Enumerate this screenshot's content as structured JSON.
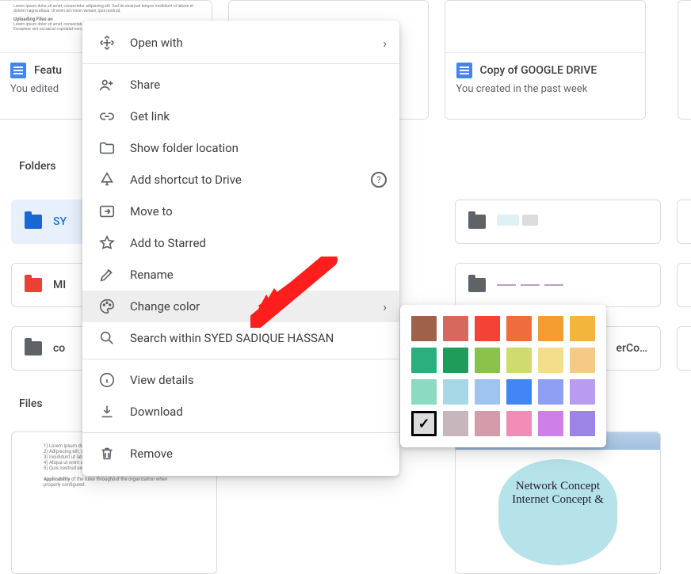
{
  "doc_cards": [
    {
      "title": "Featu",
      "subtitle": "You edited"
    },
    {
      "title": "",
      "subtitle": ""
    },
    {
      "title": "Copy of GOOGLE DRIVE",
      "subtitle": "You created in the past week"
    }
  ],
  "sections": {
    "folders": "Folders",
    "files": "Files"
  },
  "folders": {
    "row1": [
      {
        "label": "SY",
        "selected": true
      },
      {
        "label": ""
      },
      {
        "label": ""
      }
    ],
    "row2": [
      {
        "label": "MI",
        "shared": true
      },
      {
        "label": ""
      },
      {
        "label": ""
      }
    ],
    "row3": [
      {
        "label": "co"
      },
      {
        "label": ""
      },
      {
        "label": "erCo…"
      }
    ]
  },
  "file_preview": {
    "slide_line1": "Network Concept",
    "slide_line2": "Internet Concept &"
  },
  "context_menu": {
    "open_with": "Open with",
    "share": "Share",
    "get_link": "Get link",
    "show_folder_location": "Show folder location",
    "add_shortcut": "Add shortcut to Drive",
    "move_to": "Move to",
    "add_to_starred": "Add to Starred",
    "rename": "Rename",
    "change_color": "Change color",
    "search_within": "Search within SYED SADIQUE HASSAN",
    "view_details": "View details",
    "download": "Download",
    "remove": "Remove"
  },
  "palette": [
    [
      "#a0614a",
      "#d6685d",
      "#f44336",
      "#ef6c3e",
      "#f39c30",
      "#f3b53b"
    ],
    [
      "#2ab07f",
      "#1f9c5a",
      "#8bc34a",
      "#cddc6d",
      "#f3df8b",
      "#f5ca86"
    ],
    [
      "#8adbc2",
      "#a7d8e8",
      "#9ec5f0",
      "#4285f4",
      "#8fa0f4",
      "#b79cf0"
    ],
    [
      "#dcdcdc",
      "#c7b6bb",
      "#d49bab",
      "#f08cb5",
      "#cf80e8",
      "#9b84e6"
    ]
  ],
  "palette_selected": {
    "row": 3,
    "col": 0
  }
}
